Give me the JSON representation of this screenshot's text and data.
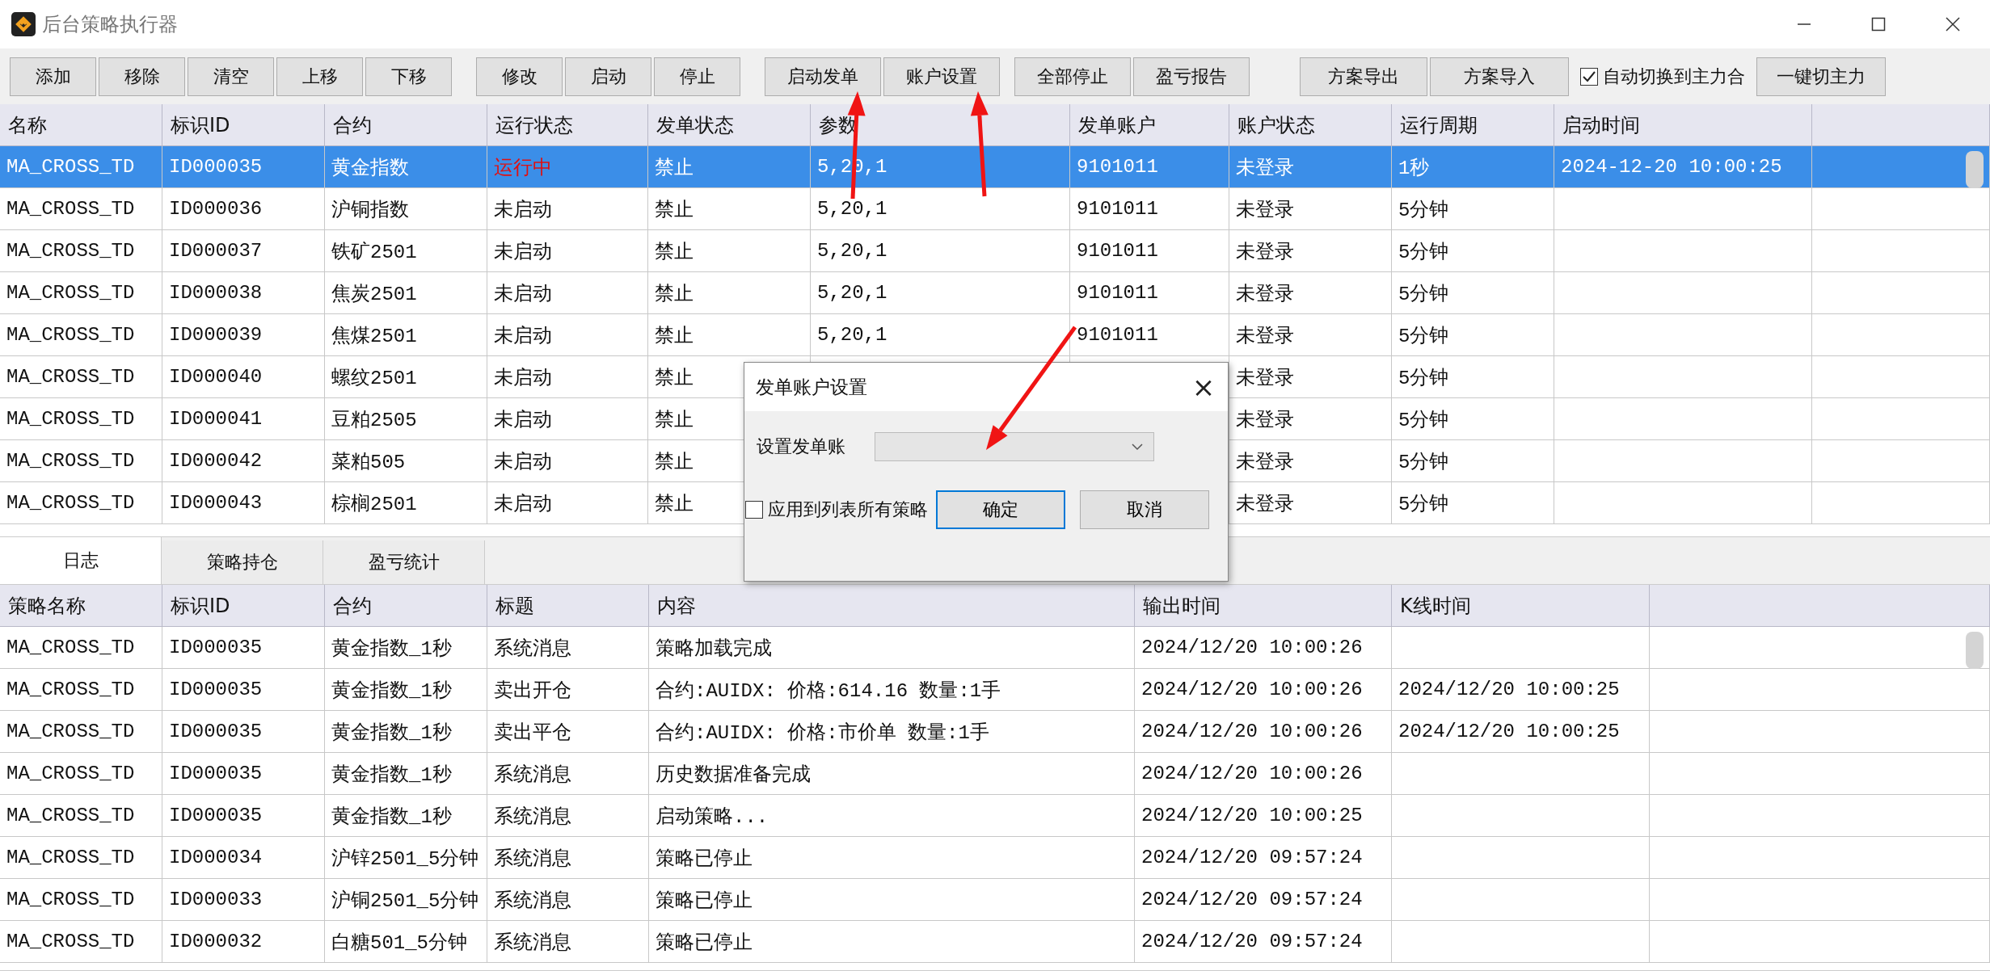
{
  "window": {
    "title": "后台策略执行器"
  },
  "toolbar": {
    "buttons": [
      "添加",
      "移除",
      "清空",
      "上移",
      "下移",
      "修改",
      "启动",
      "停止",
      "启动发单",
      "账户设置",
      "全部停止",
      "盈亏报告",
      "方案导出",
      "方案导入"
    ],
    "auto_switch": {
      "label": "自动切换到主力合",
      "checked": true
    },
    "main_button": "一键切主力"
  },
  "strategy_table": {
    "columns": [
      "名称",
      "标识ID",
      "合约",
      "运行状态",
      "发单状态",
      "参数",
      "发单账户",
      "账户状态",
      "运行周期",
      "启动时间"
    ],
    "rows": [
      {
        "selected": true,
        "running": true,
        "name": "MA_CROSS_TD",
        "id": "ID000035",
        "contract": "黄金指数",
        "run_state": "运行中",
        "order_state": "禁止",
        "params": "5,20,1",
        "account": "9101011",
        "account_state": "未登录",
        "period": "1秒",
        "start_time": "2024-12-20 10:00:25"
      },
      {
        "selected": false,
        "running": false,
        "name": "MA_CROSS_TD",
        "id": "ID000036",
        "contract": "沪铜指数",
        "run_state": "未启动",
        "order_state": "禁止",
        "params": "5,20,1",
        "account": "9101011",
        "account_state": "未登录",
        "period": "5分钟"
      },
      {
        "selected": false,
        "running": false,
        "name": "MA_CROSS_TD",
        "id": "ID000037",
        "contract": "铁矿2501",
        "run_state": "未启动",
        "order_state": "禁止",
        "params": "5,20,1",
        "account": "9101011",
        "account_state": "未登录",
        "period": "5分钟"
      },
      {
        "selected": false,
        "running": false,
        "name": "MA_CROSS_TD",
        "id": "ID000038",
        "contract": "焦炭2501",
        "run_state": "未启动",
        "order_state": "禁止",
        "params": "5,20,1",
        "account": "9101011",
        "account_state": "未登录",
        "period": "5分钟"
      },
      {
        "selected": false,
        "running": false,
        "name": "MA_CROSS_TD",
        "id": "ID000039",
        "contract": "焦煤2501",
        "run_state": "未启动",
        "order_state": "禁止",
        "params": "5,20,1",
        "account": "9101011",
        "account_state": "未登录",
        "period": "5分钟"
      },
      {
        "selected": false,
        "running": false,
        "name": "MA_CROSS_TD",
        "id": "ID000040",
        "contract": "螺纹2501",
        "run_state": "未启动",
        "order_state": "禁止",
        "account_state": "未登录",
        "period": "5分钟"
      },
      {
        "selected": false,
        "running": false,
        "name": "MA_CROSS_TD",
        "id": "ID000041",
        "contract": "豆粕2505",
        "run_state": "未启动",
        "order_state": "禁止",
        "account_state": "未登录",
        "period": "5分钟"
      },
      {
        "selected": false,
        "running": false,
        "name": "MA_CROSS_TD",
        "id": "ID000042",
        "contract": "菜粕505",
        "run_state": "未启动",
        "order_state": "禁止",
        "account_state": "未登录",
        "period": "5分钟"
      },
      {
        "selected": false,
        "running": false,
        "name": "MA_CROSS_TD",
        "id": "ID000043",
        "contract": "棕榈2501",
        "run_state": "未启动",
        "order_state": "禁止",
        "account_state": "未登录",
        "period": "5分钟"
      }
    ]
  },
  "bottom_tabs": [
    {
      "label": "日志",
      "selected": true
    },
    {
      "label": "策略持仓",
      "selected": false
    },
    {
      "label": "盈亏统计",
      "selected": false
    }
  ],
  "log_table": {
    "columns": [
      "策略名称",
      "标识ID",
      "合约",
      "标题",
      "内容",
      "输出时间",
      "K线时间"
    ],
    "rows": [
      {
        "strategy": "MA_CROSS_TD",
        "id": "ID000035",
        "contract": "黄金指数_1秒",
        "title": "系统消息",
        "content": "策略加载完成",
        "output_time": "2024/12/20 10:00:26"
      },
      {
        "strategy": "MA_CROSS_TD",
        "id": "ID000035",
        "contract": "黄金指数_1秒",
        "title": "卖出开仓",
        "content": "合约:AUIDX: 价格:614.16 数量:1手",
        "output_time": "2024/12/20 10:00:26",
        "bar_time": "2024/12/20 10:00:25"
      },
      {
        "strategy": "MA_CROSS_TD",
        "id": "ID000035",
        "contract": "黄金指数_1秒",
        "title": "卖出平仓",
        "content": "合约:AUIDX: 价格:市价单 数量:1手",
        "output_time": "2024/12/20 10:00:26",
        "bar_time": "2024/12/20 10:00:25"
      },
      {
        "strategy": "MA_CROSS_TD",
        "id": "ID000035",
        "contract": "黄金指数_1秒",
        "title": "系统消息",
        "content": "历史数据准备完成",
        "output_time": "2024/12/20 10:00:26"
      },
      {
        "strategy": "MA_CROSS_TD",
        "id": "ID000035",
        "contract": "黄金指数_1秒",
        "title": "系统消息",
        "content": "启动策略...",
        "output_time": "2024/12/20 10:00:25"
      },
      {
        "strategy": "MA_CROSS_TD",
        "id": "ID000034",
        "contract": "沪锌2501_5分钟",
        "title": "系统消息",
        "content": "策略已停止",
        "output_time": "2024/12/20 09:57:24"
      },
      {
        "strategy": "MA_CROSS_TD",
        "id": "ID000033",
        "contract": "沪铜2501_5分钟",
        "title": "系统消息",
        "content": "策略已停止",
        "output_time": "2024/12/20 09:57:24"
      },
      {
        "strategy": "MA_CROSS_TD",
        "id": "ID000032",
        "contract": "白糖501_5分钟",
        "title": "系统消息",
        "content": "策略已停止",
        "output_time": "2024/12/20 09:57:24"
      }
    ]
  },
  "dialog": {
    "title": "发单账户设置",
    "close": "×",
    "field_label": "设置发单账",
    "apply_all": {
      "label": "应用到列表所有策略",
      "checked": false
    },
    "buttons": [
      {
        "label": "确定",
        "default": true
      },
      {
        "label": "取消",
        "default": false
      }
    ]
  }
}
